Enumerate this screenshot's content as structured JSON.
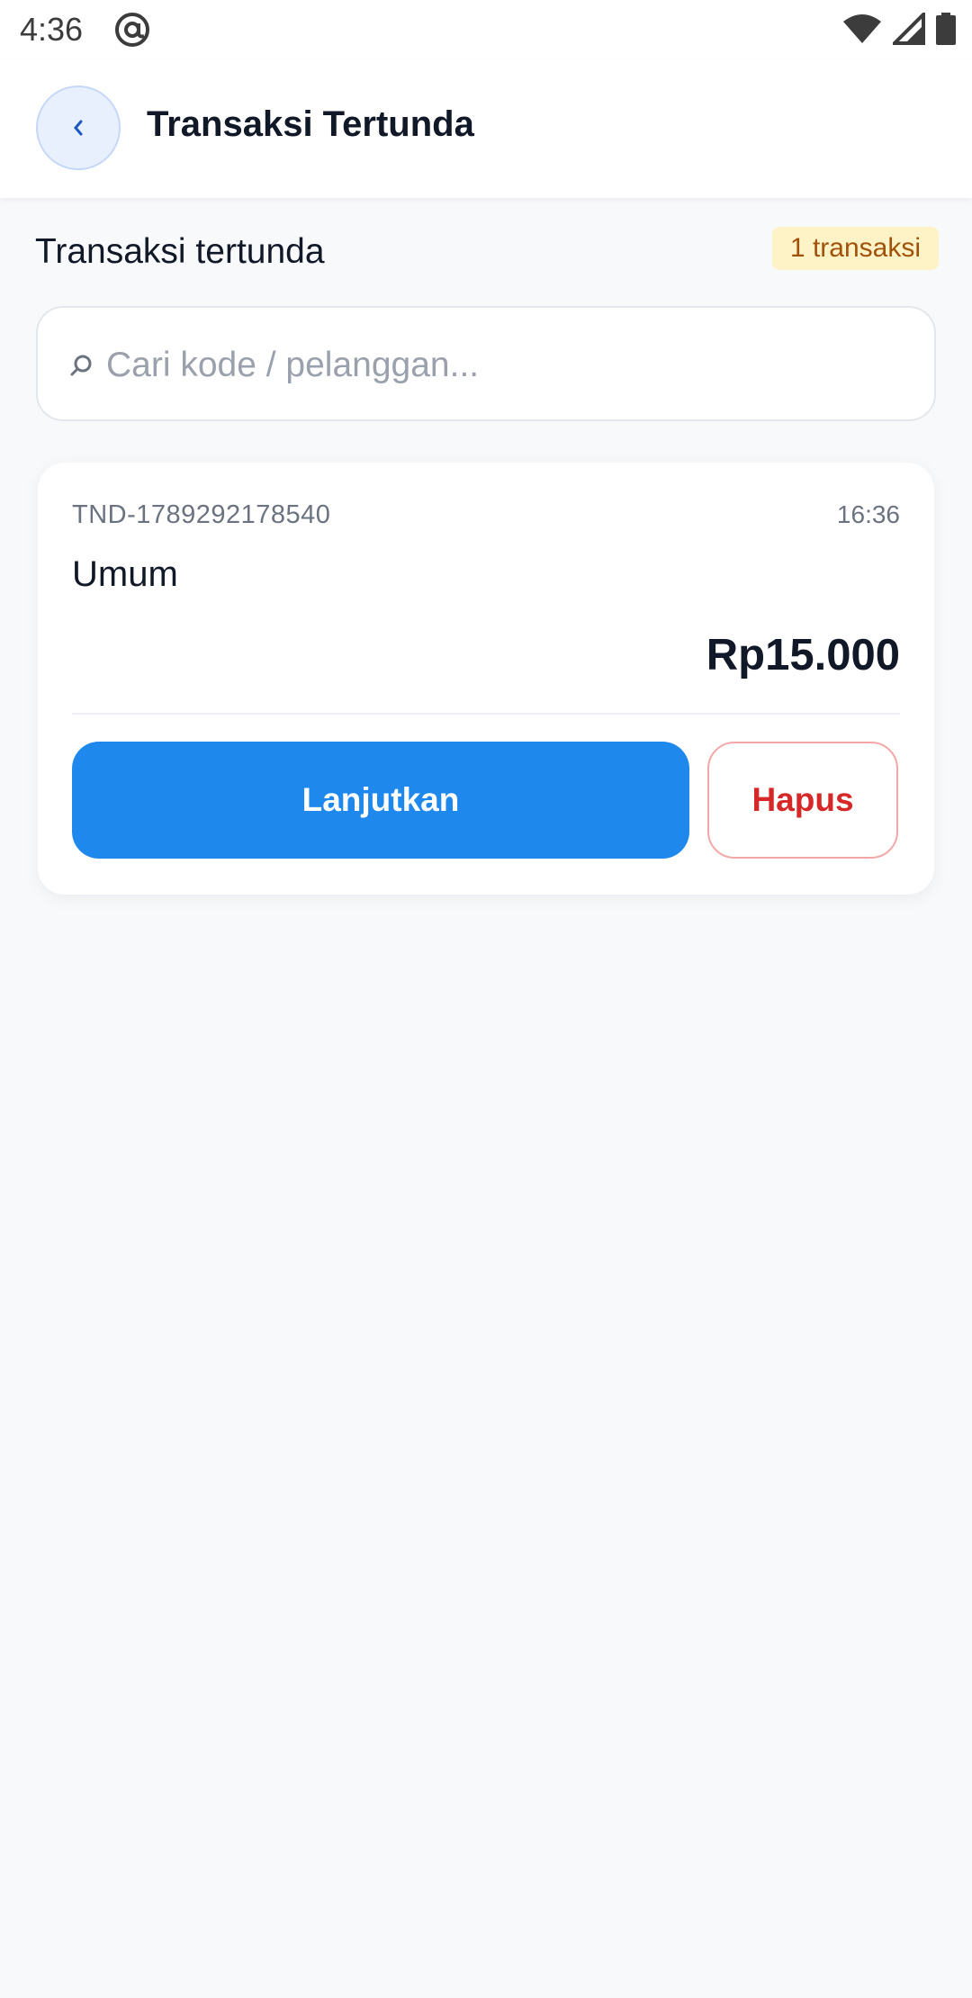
{
  "status_bar": {
    "time": "4:36",
    "icons": [
      "at-sign-icon",
      "wifi-icon",
      "cellular-signal-icon",
      "battery-icon"
    ]
  },
  "app_bar": {
    "back_icon": "chevron-left-icon",
    "title": "Transaksi Tertunda"
  },
  "section": {
    "title": "Transaksi tertunda",
    "count_badge": "1 transaksi"
  },
  "search": {
    "icon": "search-icon",
    "placeholder": "Cari kode / pelanggan...",
    "value": ""
  },
  "transactions": [
    {
      "code": "TND-1789292178540",
      "time": "16:36",
      "customer": "Umum",
      "total": "Rp15.000",
      "continue_label": "Lanjutkan",
      "delete_label": "Hapus"
    }
  ],
  "colors": {
    "primary": "#1e88ed",
    "danger": "#d62828",
    "badge_bg": "#fdf3c7",
    "badge_text": "#a0520b",
    "background": "#f8f9fb"
  }
}
